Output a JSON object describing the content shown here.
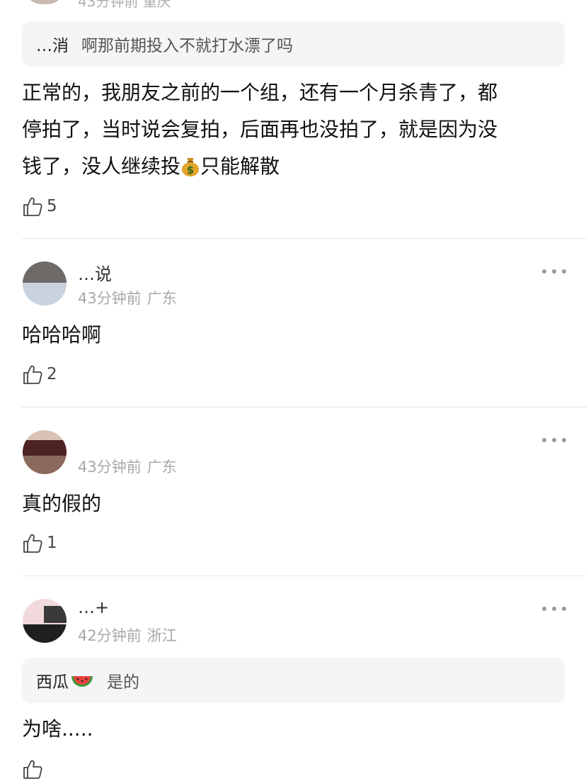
{
  "top_comment": {
    "meta": "43分钟前 重庆",
    "quote": {
      "author": "…消",
      "text": "啊那前期投入不就打水漂了吗"
    },
    "body": [
      "正常的，我朋友之前的一个组，还有一个月杀青了，都",
      "停拍了，当时说会复拍，后面再也没拍了，就是因为没",
      "钱了，没人继续投",
      "只能解散"
    ],
    "emoji": "money-bag",
    "likes": "5"
  },
  "comments": [
    {
      "username": "…说",
      "time": "43分钟前",
      "location": "广东",
      "body": "哈哈哈啊",
      "likes": "2"
    },
    {
      "username": "",
      "time": "43分钟前",
      "location": "广东",
      "body": "真的假的",
      "likes": "1"
    },
    {
      "username": "…+",
      "time": "42分钟前",
      "location": "浙江",
      "quote": {
        "author": "西瓜",
        "text": "是的"
      },
      "body": "为啥.....",
      "likes": ""
    }
  ],
  "icons": {
    "like": "thumbs-up-outline-icon",
    "more": "more-dots-icon",
    "melon": "watermelon-emoji"
  },
  "colors": {
    "quote_bg": "#f5f5f5",
    "meta_text": "#a8a8a8",
    "divider": "#e4e4e4"
  }
}
